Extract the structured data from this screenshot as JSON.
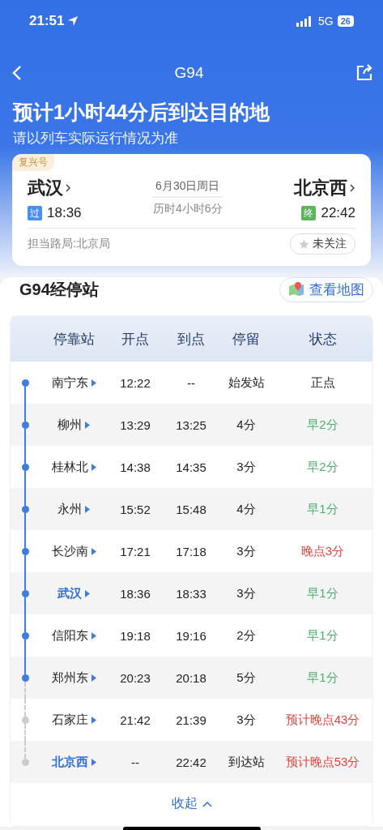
{
  "status_bar": {
    "time": "21:51",
    "network": "5G",
    "battery": "26"
  },
  "nav": {
    "title": "G94"
  },
  "headline": "预计1小时44分后到达目的地",
  "subtitle": "请以列车实际运行情况为准",
  "trip": {
    "badge": "复兴号",
    "from": {
      "station": "武汉",
      "tag": "过",
      "time": "18:36"
    },
    "date": "6月30日周日",
    "duration": "历时4小时6分",
    "to": {
      "station": "北京西",
      "tag": "终",
      "time": "22:42"
    },
    "bureau": "担当路局:北京局",
    "follow": {
      "label": "未关注",
      "on": false
    }
  },
  "stops_section": {
    "title": "G94经停站",
    "map_button": "查看地图"
  },
  "table": {
    "columns": [
      "停靠站",
      "开点",
      "到点",
      "停留",
      "状态"
    ],
    "rows": [
      {
        "station": "南宁东",
        "depart": "12:22",
        "arrive": "--",
        "stop": "始发站",
        "status": "正点",
        "kind": "ontime",
        "highlighted": false,
        "passed": true
      },
      {
        "station": "柳州",
        "depart": "13:29",
        "arrive": "13:25",
        "stop": "4分",
        "status": "早2分",
        "kind": "early",
        "highlighted": false,
        "passed": true
      },
      {
        "station": "桂林北",
        "depart": "14:38",
        "arrive": "14:35",
        "stop": "3分",
        "status": "早2分",
        "kind": "early",
        "highlighted": false,
        "passed": true
      },
      {
        "station": "永州",
        "depart": "15:52",
        "arrive": "15:48",
        "stop": "4分",
        "status": "早1分",
        "kind": "early",
        "highlighted": false,
        "passed": true
      },
      {
        "station": "长沙南",
        "depart": "17:21",
        "arrive": "17:18",
        "stop": "3分",
        "status": "晚点3分",
        "kind": "late",
        "highlighted": false,
        "passed": true
      },
      {
        "station": "武汉",
        "depart": "18:36",
        "arrive": "18:33",
        "stop": "3分",
        "status": "早1分",
        "kind": "early",
        "highlighted": true,
        "passed": true
      },
      {
        "station": "信阳东",
        "depart": "19:18",
        "arrive": "19:16",
        "stop": "2分",
        "status": "早1分",
        "kind": "early",
        "highlighted": false,
        "passed": true
      },
      {
        "station": "郑州东",
        "depart": "20:23",
        "arrive": "20:18",
        "stop": "5分",
        "status": "早1分",
        "kind": "early",
        "highlighted": false,
        "passed": true
      },
      {
        "station": "石家庄",
        "depart": "21:42",
        "arrive": "21:39",
        "stop": "3分",
        "status": "预计晚点43分",
        "kind": "late",
        "highlighted": false,
        "passed": false
      },
      {
        "station": "北京西",
        "depart": "--",
        "arrive": "22:42",
        "stop": "到达站",
        "status": "预计晚点53分",
        "kind": "late",
        "highlighted": true,
        "passed": false
      }
    ],
    "collapse": "收起"
  }
}
